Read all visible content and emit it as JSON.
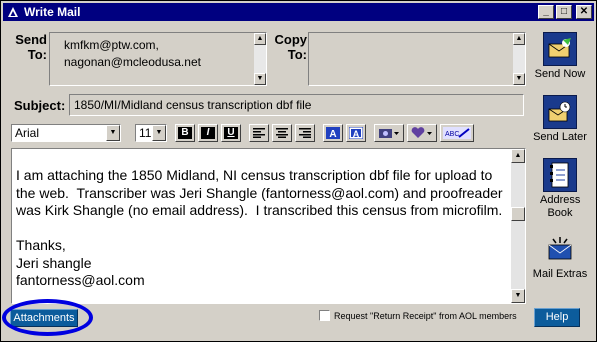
{
  "window": {
    "title": "Write Mail"
  },
  "titlebar_buttons": {
    "minimize": "_",
    "maximize": "□",
    "close": "✕"
  },
  "send_to": {
    "label_line1": "Send",
    "label_line2": "To:",
    "recipients": [
      "kmfkm@ptw.com,",
      "nagonan@mcleodusa.net"
    ]
  },
  "copy_to": {
    "label_line1": "Copy",
    "label_line2": "To:",
    "recipients": []
  },
  "subject": {
    "label": "Subject:",
    "value": "1850/MI/Midland census transcription dbf file"
  },
  "format_toolbar": {
    "font": "Arial",
    "size": "11",
    "bold": "B",
    "italic": "I",
    "underline": "U",
    "spell_check": "ABC"
  },
  "message": {
    "body": "I am attaching the 1850 Midland, NI census transcription dbf file for upload to the web.  Transcriber was Jeri Shangle (fantorness@aol.com) and proofreader was Kirk Shangle (no email address).  I transcribed this census from microfilm.\n\nThanks,\nJeri shangle\nfantorness@aol.com"
  },
  "side_actions": [
    {
      "label": "Send Now",
      "icon": "send-now-icon"
    },
    {
      "label": "Send Later",
      "icon": "send-later-icon"
    },
    {
      "label": "Address Book",
      "icon": "address-book-icon"
    },
    {
      "label": "Mail Extras",
      "icon": "mail-extras-icon"
    }
  ],
  "bottom": {
    "attachments_label": "Attachments",
    "receipt_label": "Request \"Return Receipt\" from AOL members",
    "help_label": "Help"
  },
  "colors": {
    "titlebar": "#000080",
    "aol_button": "#0c5c9c",
    "highlight_ring": "#0000e0"
  }
}
